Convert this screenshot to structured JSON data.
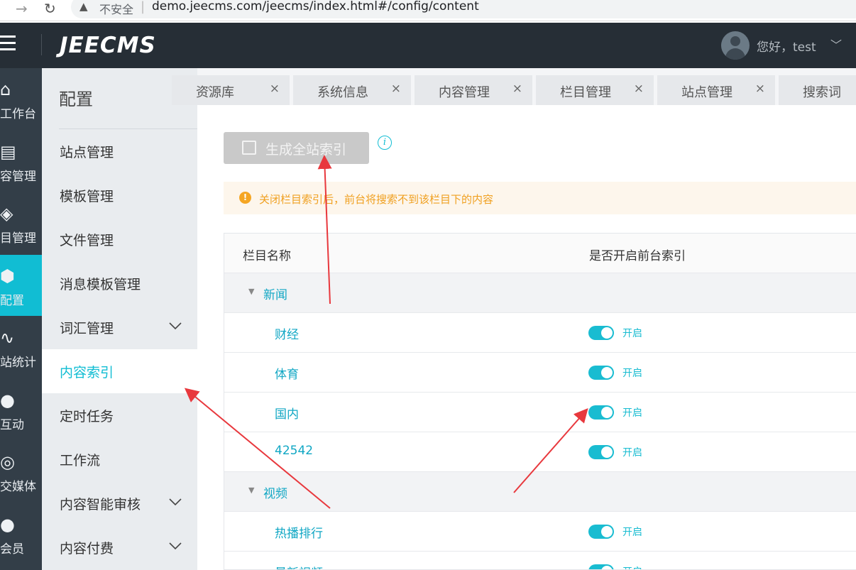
{
  "browser": {
    "back_icon": "arrow-left-icon",
    "reload_icon": "reload-icon",
    "insecure_label": "不安全",
    "url": "demo.jeecms.com/jeecms/index.html#/config/content"
  },
  "header": {
    "logo": "JEECMS",
    "greeting": "您好，test"
  },
  "rail": {
    "items": [
      {
        "label": "工作台",
        "icon": "home-icon"
      },
      {
        "label": "容管理",
        "icon": "document-icon"
      },
      {
        "label": "目管理",
        "icon": "layers-icon"
      },
      {
        "label": "配置",
        "icon": "cube-icon"
      },
      {
        "label": "站统计",
        "icon": "chart-icon"
      },
      {
        "label": "互动",
        "icon": "chat-icon"
      },
      {
        "label": "交媒体",
        "icon": "social-icon"
      },
      {
        "label": "会员",
        "icon": "member-icon"
      }
    ],
    "active_index": 3
  },
  "submenu": {
    "title": "配置",
    "items": [
      {
        "label": "站点管理",
        "chevron": false
      },
      {
        "label": "模板管理",
        "chevron": false
      },
      {
        "label": "文件管理",
        "chevron": false
      },
      {
        "label": "消息模板管理",
        "chevron": false
      },
      {
        "label": "词汇管理",
        "chevron": true
      },
      {
        "label": "内容索引",
        "chevron": false
      },
      {
        "label": "定时任务",
        "chevron": false
      },
      {
        "label": "工作流",
        "chevron": false
      },
      {
        "label": "内容智能审核",
        "chevron": true
      },
      {
        "label": "内容付费",
        "chevron": true
      }
    ],
    "active_index": 5
  },
  "tabs": {
    "items": [
      {
        "label": "资源库"
      },
      {
        "label": "系统信息"
      },
      {
        "label": "内容管理"
      },
      {
        "label": "栏目管理"
      },
      {
        "label": "站点管理"
      },
      {
        "label": "搜索词"
      }
    ],
    "close_symbol": "×"
  },
  "content": {
    "generate_button": "生成全站索引",
    "alert_text": "关闭栏目索引后，前台将搜索不到该栏目下的内容",
    "table": {
      "col_name": "栏目名称",
      "col_index": "是否开启前台索引",
      "rows": [
        {
          "type": "group",
          "name": "新闻"
        },
        {
          "type": "child",
          "name": "财经",
          "status": "开启",
          "on": true
        },
        {
          "type": "child",
          "name": "体育",
          "status": "开启",
          "on": true
        },
        {
          "type": "child",
          "name": "国内",
          "status": "开启",
          "on": true
        },
        {
          "type": "child",
          "name": "42542",
          "status": "开启",
          "on": true
        },
        {
          "type": "group",
          "name": "视频"
        },
        {
          "type": "child",
          "name": "热播排行",
          "status": "开启",
          "on": true
        },
        {
          "type": "child",
          "name": "最新视频",
          "status": "开启",
          "on": true
        }
      ]
    }
  },
  "colors": {
    "accent": "#11bdd3",
    "header_bg": "#262e36",
    "rail_bg": "#333e48",
    "annotation_arrow": "#e8383d"
  }
}
